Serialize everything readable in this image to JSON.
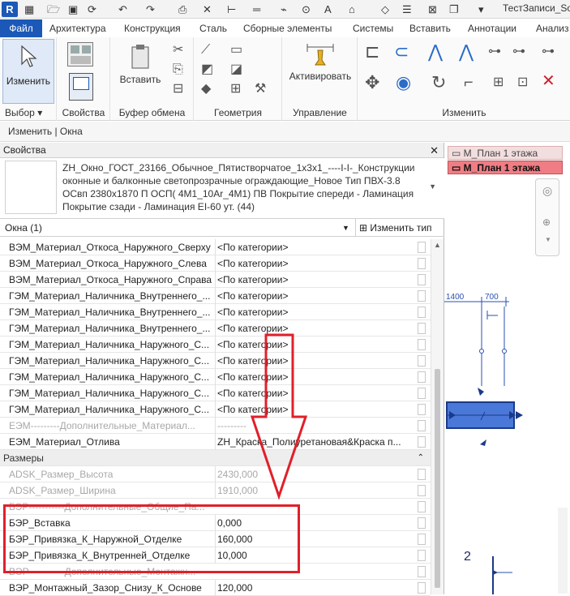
{
  "qat": {
    "logo": "R",
    "title": "ТестЗаписи_Sobo",
    "icons": [
      "grid-icon",
      "folder-open-icon",
      "save-icon",
      "sync-icon",
      "undo-icon",
      "redo-icon",
      "print-icon",
      "measure-icon",
      "wall-icon",
      "tag-icon",
      "text-icon",
      "home-icon",
      "pin-icon",
      "list-icon",
      "close-window-icon",
      "switch-window-icon",
      "dropdown-icon"
    ]
  },
  "tabs": [
    "Файл",
    "Архитектура",
    "Конструкция",
    "Сталь",
    "Сборные элементы",
    "Системы",
    "Вставить",
    "Аннотации",
    "Анализ"
  ],
  "ribbon": {
    "modify_label": "Изменить",
    "paste_label": "Вставить",
    "activate_label": "Активировать",
    "panels": [
      "Выбор",
      "Свойства",
      "Буфер обмена",
      "Геометрия",
      "Управление",
      "Изменить"
    ],
    "select_dropdown": "▾"
  },
  "status": {
    "context": "Изменить | Окна"
  },
  "properties": {
    "title": "Свойства",
    "close": "✕",
    "type_text": "ZH_Окно_ГОСТ_23166_Обычное_Пятистворчатое_1х3х1_----I-I-_Конструкции оконные и балконные светопрозрачные ограждающие_Новое Тип ПВХ-3.8 ОСвп 2380х1870 П ОСП( 4М1_10Ar_4М1) ПВ Покрытие спереди - Ламинация Покрытие сзади - Ламинация EI-60 ут. (44)",
    "instance_label": "Окна (1)",
    "edit_type": "Изменить тип"
  },
  "rows": [
    {
      "name": "ВЭМ_Материал_Откоса_Наружного_Сверху",
      "value": "<По категории>",
      "style": "normal"
    },
    {
      "name": "ВЭМ_Материал_Откоса_Наружного_Слева",
      "value": "<По категории>",
      "style": "normal"
    },
    {
      "name": "ВЭМ_Материал_Откоса_Наружного_Справа",
      "value": "<По категории>",
      "style": "normal"
    },
    {
      "name": "ГЭМ_Материал_Наличника_Внутреннего_...",
      "value": "<По категории>",
      "style": "normal"
    },
    {
      "name": "ГЭМ_Материал_Наличника_Внутреннего_...",
      "value": "<По категории>",
      "style": "normal"
    },
    {
      "name": "ГЭМ_Материал_Наличника_Внутреннего_...",
      "value": "<По категории>",
      "style": "normal"
    },
    {
      "name": "ГЭМ_Материал_Наличника_Наружного_С...",
      "value": "<По категории>",
      "style": "normal"
    },
    {
      "name": "ГЭМ_Материал_Наличника_Наружного_С...",
      "value": "<По категории>",
      "style": "normal"
    },
    {
      "name": "ГЭМ_Материал_Наличника_Наружного_С...",
      "value": "<По категории>",
      "style": "normal"
    },
    {
      "name": "ГЭМ_Материал_Наличника_Наружного_С...",
      "value": "<По категории>",
      "style": "normal"
    },
    {
      "name": "ГЭМ_Материал_Наличника_Наружного_С...",
      "value": "<По категории>",
      "style": "normal"
    },
    {
      "name": "ЕЭМ---------Дополнительные_Материал...",
      "value": "---------",
      "style": "grey"
    },
    {
      "name": "ЕЭМ_Материал_Отлива",
      "value": "ZH_Краска_Полиуретановая&Краска п...",
      "style": "normal"
    },
    {
      "name": "Размеры",
      "value": "",
      "style": "header"
    },
    {
      "name": "ADSK_Размер_Высота",
      "value": "2430,000",
      "style": "grey"
    },
    {
      "name": "ADSK_Размер_Ширина",
      "value": "1910,000",
      "style": "grey"
    },
    {
      "name": "БЭР-----------Дополнительные_Общие_Па...",
      "value": "",
      "style": "grey"
    },
    {
      "name": "БЭР_Вставка",
      "value": "0,000",
      "style": "normal"
    },
    {
      "name": "БЭР_Привязка_К_Наружной_Отделке",
      "value": "160,000",
      "style": "normal"
    },
    {
      "name": "БЭР_Привязка_К_Внутренней_Отделке",
      "value": "10,000",
      "style": "normal"
    },
    {
      "name": "ВЭР-----------Дополнительные_Монтажн...",
      "value": "",
      "style": "grey"
    },
    {
      "name": "ВЭР_Монтажный_Зазор_Снизу_К_Основе",
      "value": "120,000",
      "style": "normal"
    }
  ],
  "view": {
    "tab1": "М_План 1 этажа",
    "tab2": "М_План 1 этажа",
    "dim1": "1400",
    "dim2": "700",
    "grid_label": "2"
  },
  "colors": {
    "accent": "#1b58b7",
    "highlight": "#e0202a"
  }
}
